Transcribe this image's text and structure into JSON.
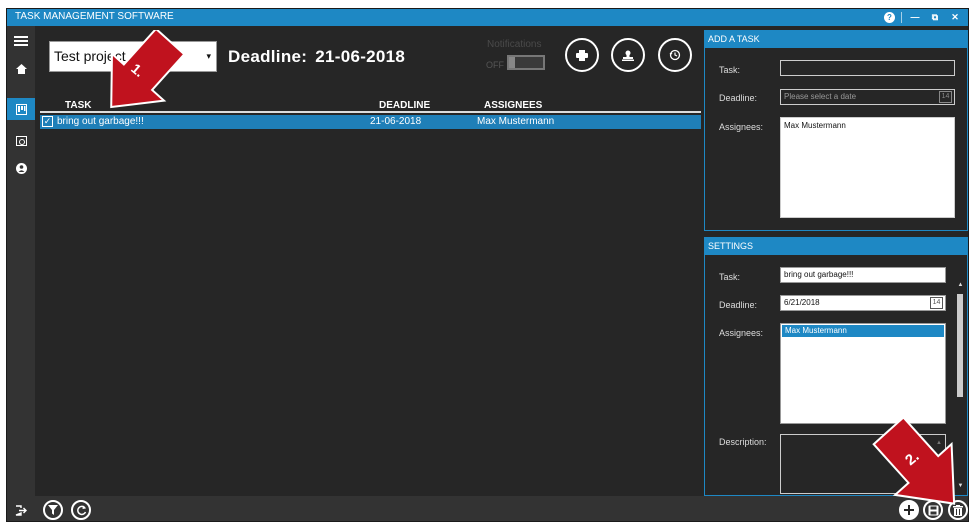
{
  "window": {
    "title": "TASK MANAGEMENT SOFTWARE"
  },
  "header": {
    "project_value": "Test project",
    "deadline_label": "Deadline:",
    "deadline_value": "21-06-2018",
    "notifications_label": "Notifications",
    "notifications_state": "OFF"
  },
  "task_table": {
    "columns": [
      "TASK",
      "DEADLINE",
      "ASSIGNEES"
    ],
    "rows": [
      {
        "task": "bring out garbage!!!",
        "deadline": "21-06-2018",
        "assignees": "Max Mustermann",
        "checked": true,
        "selected": true
      }
    ]
  },
  "add_task_panel": {
    "title": "ADD A TASK",
    "task_label": "Task:",
    "task_value": "",
    "deadline_label": "Deadline:",
    "deadline_placeholder": "Please select a date",
    "assignees_label": "Assignees:",
    "assignees": [
      "Max Mustermann"
    ]
  },
  "settings_panel": {
    "title": "SETTINGS",
    "task_label": "Task:",
    "task_value": "bring out garbage!!!",
    "deadline_label": "Deadline:",
    "deadline_value": "6/21/2018",
    "assignees_label": "Assignees:",
    "assignees": [
      "Max Mustermann"
    ],
    "description_label": "Description:"
  },
  "annotations": {
    "arrow1_label": "1.",
    "arrow2_label": "2."
  },
  "calendar_day": "14",
  "colors": {
    "accent": "#1e88c4",
    "background": "#262626",
    "arrow": "#c0121e"
  }
}
